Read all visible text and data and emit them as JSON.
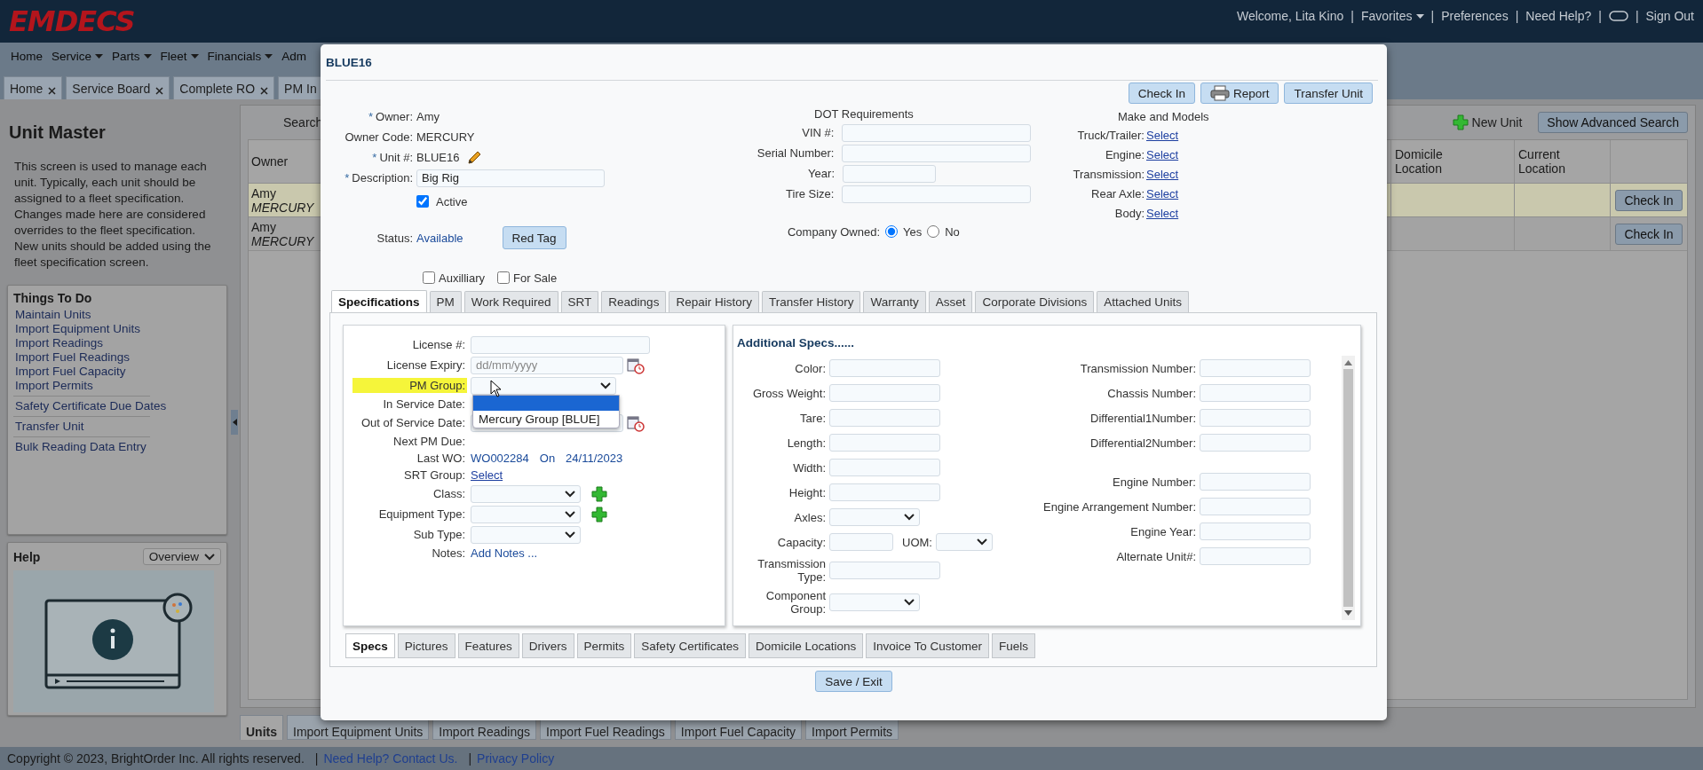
{
  "header": {
    "logo": "EMDECS",
    "menu": [
      {
        "kind": "text",
        "label": "Welcome, Lita Kino"
      },
      {
        "kind": "separator",
        "label": "|"
      },
      {
        "kind": "menu",
        "label": "Favorites"
      },
      {
        "kind": "separator",
        "label": "|"
      },
      {
        "kind": "link",
        "label": "Preferences"
      },
      {
        "kind": "separator",
        "label": "|"
      },
      {
        "kind": "link",
        "label": "Need Help?"
      },
      {
        "kind": "separator",
        "label": "|"
      },
      {
        "kind": "chat"
      },
      {
        "kind": "separator",
        "label": "|"
      },
      {
        "kind": "link",
        "label": "Sign Out"
      }
    ]
  },
  "nav": [
    {
      "label": "Home",
      "dropdown": false
    },
    {
      "label": "Service",
      "dropdown": true
    },
    {
      "label": "Parts",
      "dropdown": true
    },
    {
      "label": "Fleet",
      "dropdown": true
    },
    {
      "label": "Financials",
      "dropdown": true
    },
    {
      "label": "Adm",
      "dropdown": false
    }
  ],
  "open_tabs": [
    {
      "label": "Home",
      "closable": true
    },
    {
      "label": "Service Board",
      "closable": true
    },
    {
      "label": "Complete RO",
      "closable": true
    },
    {
      "label": "PM In",
      "closable": false
    }
  ],
  "sidebar": {
    "title": "Unit Master",
    "description": "This screen is used to manage each unit. Typically, each unit should be assigned to a fleet specification. Changes made here are considered overrides to the fleet specification. New units should be added using the fleet specification screen.",
    "things_to_do": {
      "title": "Things To Do",
      "groups": [
        [
          "Maintain Units",
          "Import Equipment Units",
          "Import Readings",
          "Import Fuel Readings",
          "Import Fuel Capacity",
          "Import Permits"
        ],
        [
          "Safety Certificate Due Dates"
        ],
        [
          "Transfer Unit"
        ],
        [
          "Bulk Reading Data Entry"
        ]
      ]
    },
    "help": {
      "title": "Help",
      "topic": "Overview"
    }
  },
  "units_panel": {
    "search_label": "Search",
    "new_unit": "New Unit",
    "advanced_search": "Show Advanced Search",
    "columns": [
      "Owner",
      "Domicile Location",
      "Current Location"
    ],
    "rows": [
      {
        "owner": "Amy",
        "owner_code": "MERCURY",
        "action": "Check In",
        "highlighted": true
      },
      {
        "owner": "Amy",
        "owner_code": "MERCURY",
        "action": "Check In",
        "highlighted": false
      }
    ]
  },
  "bottom_tabs": [
    {
      "label": "Units",
      "selected": true
    },
    {
      "label": "Import Equipment Units",
      "selected": false
    },
    {
      "label": "Import Readings",
      "selected": false
    },
    {
      "label": "Import Fuel Readings",
      "selected": false
    },
    {
      "label": "Import Fuel Capacity",
      "selected": false
    },
    {
      "label": "Import Permits",
      "selected": false
    }
  ],
  "footer": [
    {
      "kind": "text",
      "label": "Copyright © 2023, BrightOrder Inc. All rights reserved."
    },
    {
      "kind": "separator",
      "label": "|"
    },
    {
      "kind": "link",
      "label": "Need Help? Contact Us."
    },
    {
      "kind": "separator",
      "label": "|"
    },
    {
      "kind": "link",
      "label": "Privacy Policy"
    }
  ],
  "dialog": {
    "title": "BLUE16",
    "actions": [
      {
        "label": "Check In",
        "kind": "plain"
      },
      {
        "label": "Report",
        "kind": "print"
      },
      {
        "label": "Transfer Unit",
        "kind": "plain"
      }
    ],
    "general": [
      {
        "kind": "text",
        "marker": "*",
        "label": "Owner:",
        "value": "Amy"
      },
      {
        "kind": "text",
        "label": "Owner Code:",
        "value": "MERCURY"
      },
      {
        "kind": "editable",
        "marker": "*",
        "label": "Unit #:",
        "value": "BLUE16"
      },
      {
        "kind": "input",
        "marker": "*",
        "label": "Description:",
        "value": "Big Rig"
      }
    ],
    "active": {
      "label": "Active",
      "checked": true
    },
    "status": {
      "label": "Status:",
      "value": "Available",
      "button": "Red Tag"
    },
    "flags": [
      {
        "label": "Auxilliary",
        "checked": false
      },
      {
        "label": "For Sale",
        "checked": false
      }
    ],
    "dot": {
      "title": "DOT Requirements",
      "fields": [
        {
          "label": "VIN #:",
          "kind": "wide"
        },
        {
          "label": "Serial Number:",
          "kind": "wide"
        },
        {
          "label": "Year:",
          "kind": "short"
        },
        {
          "label": "Tire Size:",
          "kind": "wide"
        }
      ]
    },
    "company_owned": {
      "label": "Company Owned:",
      "options": [
        {
          "label": "Yes",
          "selected": true
        },
        {
          "label": "No",
          "selected": false
        }
      ]
    },
    "make_models": {
      "title": "Make and Models",
      "fields": [
        {
          "label": "Truck/Trailer:",
          "link": "Select"
        },
        {
          "label": "Engine:",
          "link": "Select"
        },
        {
          "label": "Transmission:",
          "link": "Select"
        },
        {
          "label": "Rear Axle:",
          "link": "Select"
        },
        {
          "label": "Body:",
          "link": "Select"
        }
      ]
    },
    "tabs": [
      {
        "label": "Specifications",
        "selected": true
      },
      {
        "label": "PM",
        "selected": false
      },
      {
        "label": "Work Required",
        "selected": false
      },
      {
        "label": "SRT",
        "selected": false
      },
      {
        "label": "Readings",
        "selected": false
      },
      {
        "label": "Repair History",
        "selected": false
      },
      {
        "label": "Transfer History",
        "selected": false
      },
      {
        "label": "Warranty",
        "selected": false
      },
      {
        "label": "Asset",
        "selected": false
      },
      {
        "label": "Corporate Divisions",
        "selected": false
      },
      {
        "label": "Attached Units",
        "selected": false
      }
    ],
    "specs": [
      {
        "kind": "input",
        "label": "License #:",
        "highlighted": false
      },
      {
        "kind": "date",
        "label": "License Expiry:",
        "placeholder": "dd/mm/yyyy",
        "highlighted": false
      },
      {
        "kind": "select_open",
        "label": "PM Group:",
        "highlighted": true,
        "options": [
          {
            "selected": true
          },
          {
            "label": "Mercury Group [BLUE]",
            "selected": false
          }
        ]
      },
      {
        "kind": "text",
        "label": "In Service Date:",
        "highlighted": false
      },
      {
        "kind": "date",
        "label": "Out of Service Date:",
        "highlighted": false
      },
      {
        "kind": "text",
        "label": "Next PM Due:",
        "highlighted": false
      },
      {
        "kind": "wo",
        "label": "Last WO:",
        "value": "WO002284",
        "on": "On",
        "date": "24/11/2023",
        "highlighted": false
      },
      {
        "kind": "link",
        "label": "SRT Group:",
        "value": "Select",
        "highlighted": false
      },
      {
        "kind": "select_add",
        "label": "Class:",
        "highlighted": false
      },
      {
        "kind": "select_add",
        "label": "Equipment Type:",
        "highlighted": false
      },
      {
        "kind": "select",
        "label": "Sub Type:",
        "highlighted": false
      },
      {
        "kind": "action",
        "label": "Notes:",
        "value": "Add Notes ...",
        "highlighted": false
      }
    ],
    "additional": {
      "title": "Additional Specs......",
      "left": [
        {
          "kind": "input",
          "label": "Color:"
        },
        {
          "kind": "input",
          "label": "Gross Weight:"
        },
        {
          "kind": "input",
          "label": "Tare:"
        },
        {
          "kind": "input",
          "label": "Length:"
        },
        {
          "kind": "input",
          "label": "Width:"
        },
        {
          "kind": "input",
          "label": "Height:"
        },
        {
          "kind": "select",
          "label": "Axles:"
        },
        {
          "kind": "input_uom",
          "label": "Capacity:",
          "unit_label": "UOM:"
        },
        {
          "kind": "input",
          "label": "Transmission Type:"
        },
        {
          "kind": "select",
          "label": "Component Group:"
        }
      ],
      "right": [
        [
          "Transmission Number:",
          "Chassis Number:",
          "Differential1Number:",
          "Differential2Number:"
        ],
        [
          "Engine Number:",
          "Engine Arrangement Number:",
          "Engine Year:",
          "Alternate Unit#:"
        ]
      ]
    },
    "sub_tabs": [
      {
        "label": "Specs",
        "selected": true
      },
      {
        "label": "Pictures",
        "selected": false
      },
      {
        "label": "Features",
        "selected": false
      },
      {
        "label": "Drivers",
        "selected": false
      },
      {
        "label": "Permits",
        "selected": false
      },
      {
        "label": "Safety Certificates",
        "selected": false
      },
      {
        "label": "Domicile Locations",
        "selected": false
      },
      {
        "label": "Invoice To Customer",
        "selected": false
      },
      {
        "label": "Fuels",
        "selected": false
      }
    ],
    "save": "Save / Exit"
  }
}
